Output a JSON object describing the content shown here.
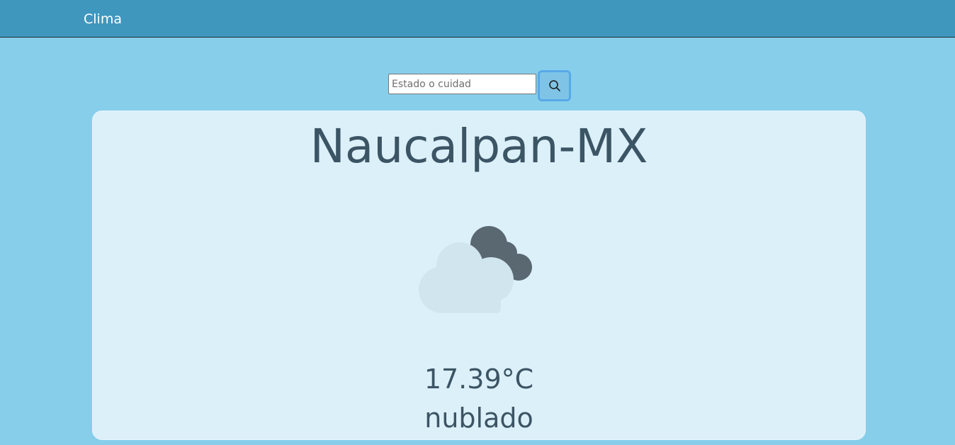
{
  "navbar": {
    "brand": "Clima",
    "background": "#3f97bd"
  },
  "search": {
    "placeholder": "Estado o cuidad",
    "value": "",
    "button_icon": "search-icon"
  },
  "weather": {
    "city": "Naucalpan-MX",
    "icon": "cloudy-icon",
    "temperature": "17.39°C",
    "description": "nublado"
  },
  "colors": {
    "page_background": "#87ceeb",
    "card_background": "#dcf0f9",
    "text": "#3c5565"
  }
}
